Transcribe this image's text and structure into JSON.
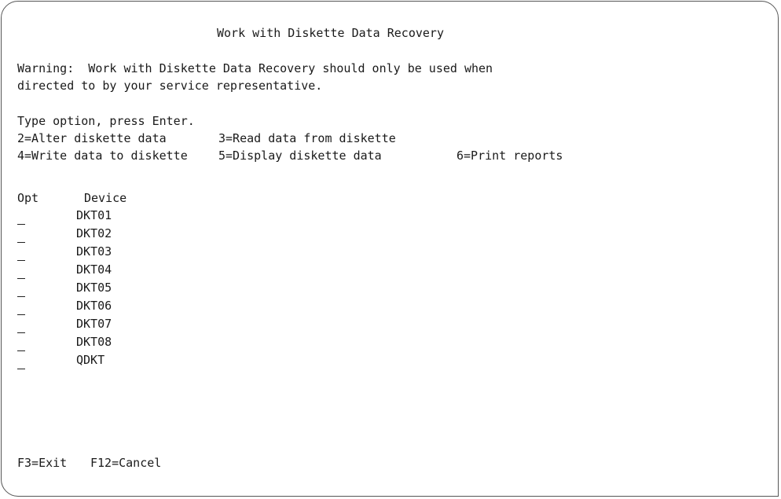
{
  "title": "Work with Diskette Data Recovery",
  "warning": {
    "line1": "Warning:  Work with Diskette Data Recovery should only be used when",
    "line2": "directed to by your service representative."
  },
  "instructions": "Type option, press Enter.",
  "options": [
    {
      "label": "2=Alter diskette data"
    },
    {
      "label": "3=Read data from diskette"
    },
    {
      "label": "4=Write data to diskette"
    },
    {
      "label": "5=Display diskette data"
    },
    {
      "label": "6=Print reports"
    }
  ],
  "columns": {
    "opt": "Opt",
    "device": "Device"
  },
  "devices": [
    {
      "opt": "",
      "name": "DKT01"
    },
    {
      "opt": "",
      "name": "DKT02"
    },
    {
      "opt": "",
      "name": "DKT03"
    },
    {
      "opt": "",
      "name": "DKT04"
    },
    {
      "opt": "",
      "name": "DKT05"
    },
    {
      "opt": "",
      "name": "DKT06"
    },
    {
      "opt": "",
      "name": "DKT07"
    },
    {
      "opt": "",
      "name": "DKT08"
    },
    {
      "opt": "",
      "name": "QDKT"
    }
  ],
  "function_keys": [
    {
      "label": "F3=Exit"
    },
    {
      "label": "F12=Cancel"
    }
  ]
}
